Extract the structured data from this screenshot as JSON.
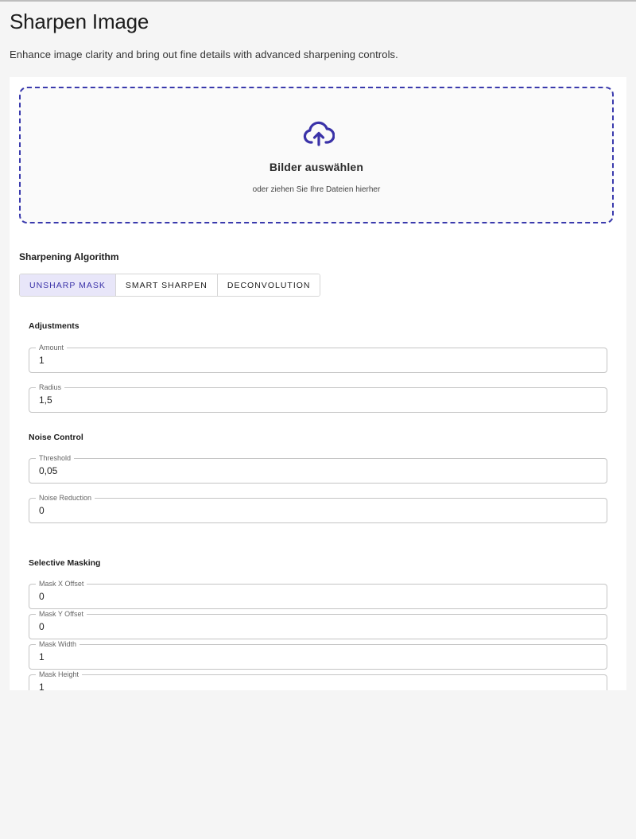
{
  "page": {
    "title": "Sharpen Image",
    "subtitle": "Enhance image clarity and bring out fine details with advanced sharpening controls."
  },
  "dropzone": {
    "icon": "cloud-upload-icon",
    "title": "Bilder auswählen",
    "subtitle": "oder ziehen Sie Ihre Dateien hierher"
  },
  "algorithm": {
    "label": "Sharpening Algorithm",
    "tabs": [
      {
        "label": "UNSHARP MASK",
        "active": true
      },
      {
        "label": "SMART SHARPEN",
        "active": false
      },
      {
        "label": "DECONVOLUTION",
        "active": false
      }
    ]
  },
  "adjustments": {
    "heading": "Adjustments",
    "amount": {
      "label": "Amount",
      "value": "1"
    },
    "radius": {
      "label": "Radius",
      "value": "1,5"
    }
  },
  "noise_control": {
    "heading": "Noise Control",
    "threshold": {
      "label": "Threshold",
      "value": "0,05"
    },
    "noise_reduction": {
      "label": "Noise Reduction",
      "value": "0"
    }
  },
  "selective_masking": {
    "heading": "Selective Masking",
    "mask_x": {
      "label": "Mask X Offset",
      "value": "0"
    },
    "mask_y": {
      "label": "Mask Y Offset",
      "value": "0"
    },
    "mask_width": {
      "label": "Mask Width",
      "value": "1"
    },
    "mask_height": {
      "label": "Mask Height",
      "value": "1"
    }
  },
  "colors": {
    "accent": "#3a32a8",
    "dropzone_border": "#3a3aad",
    "active_tab_bg": "#e8e6f9",
    "background": "#f5f5f5"
  }
}
